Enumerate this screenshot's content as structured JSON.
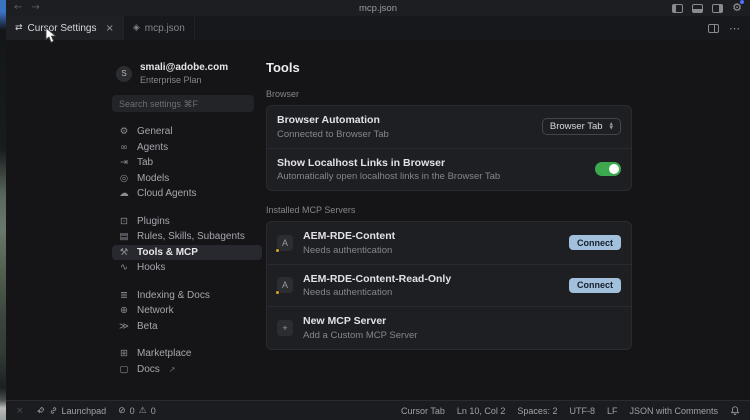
{
  "titlebar": {
    "title": "mcp.json"
  },
  "icons": {
    "back": "←",
    "forward": "→",
    "settings_tab": "⇄",
    "json_file": "◈",
    "close": "×",
    "more": "⋯",
    "stepper_up": "▲",
    "stepper_down": "▼",
    "error": "⊘",
    "warning": "⚠",
    "cross": "×",
    "gear": "⚙",
    "external": "↗"
  },
  "tabbar": {
    "tabs": [
      {
        "label": "Cursor Settings"
      },
      {
        "label": "mcp.json"
      }
    ]
  },
  "settings": {
    "account": {
      "avatar_letter": "S",
      "email": "smali@adobe.com",
      "plan": "Enterprise Plan"
    },
    "search_placeholder": "Search settings ⌘F",
    "nav_groups": [
      {
        "items": [
          {
            "label": "General",
            "icon": "⚙"
          },
          {
            "label": "Agents",
            "icon": "∞"
          },
          {
            "label": "Tab",
            "icon": "⇥"
          },
          {
            "label": "Models",
            "icon": "◎"
          },
          {
            "label": "Cloud Agents",
            "icon": "☁"
          }
        ]
      },
      {
        "items": [
          {
            "label": "Plugins",
            "icon": "⊡"
          },
          {
            "label": "Rules, Skills, Subagents",
            "icon": "▤"
          },
          {
            "label": "Tools & MCP",
            "icon": "⚒"
          },
          {
            "label": "Hooks",
            "icon": "∿"
          }
        ]
      },
      {
        "items": [
          {
            "label": "Indexing & Docs",
            "icon": "≣"
          },
          {
            "label": "Network",
            "icon": "⊕"
          },
          {
            "label": "Beta",
            "icon": "≫"
          }
        ]
      },
      {
        "items": [
          {
            "label": "Marketplace",
            "icon": "⊞"
          },
          {
            "label": "Docs",
            "icon": "▢"
          }
        ]
      }
    ]
  },
  "main": {
    "heading": "Tools",
    "browser": {
      "section_label": "Browser",
      "automation": {
        "title": "Browser Automation",
        "subtitle": "Connected to Browser Tab",
        "dropdown_value": "Browser Tab"
      },
      "localhost": {
        "title": "Show Localhost Links in Browser",
        "subtitle": "Automatically open localhost links in the Browser Tab"
      }
    },
    "mcp": {
      "section_label": "Installed MCP Servers",
      "servers": [
        {
          "name": "AEM-RDE-Content",
          "status": "Needs authentication",
          "avatar_letter": "A",
          "action": "Connect"
        },
        {
          "name": "AEM-RDE-Content-Read-Only",
          "status": "Needs authentication",
          "avatar_letter": "A",
          "action": "Connect"
        },
        {
          "name": "New MCP Server",
          "status": "Add a Custom MCP Server",
          "avatar_letter": "+"
        }
      ]
    }
  },
  "statusbar": {
    "launchpad": "Launchpad",
    "errors": "0",
    "warnings": "0",
    "cursor_tab": "Cursor Tab",
    "position": "Ln 10, Col 2",
    "indentation": "Spaces: 2",
    "encoding": "UTF-8",
    "eol": "LF",
    "language": "JSON with Comments"
  },
  "colors": {
    "toggle_green": "#3da94f",
    "connect_button": "#a2bfdb",
    "warning_dot": "#d9a521",
    "gear_badge": "#4c6fff"
  }
}
